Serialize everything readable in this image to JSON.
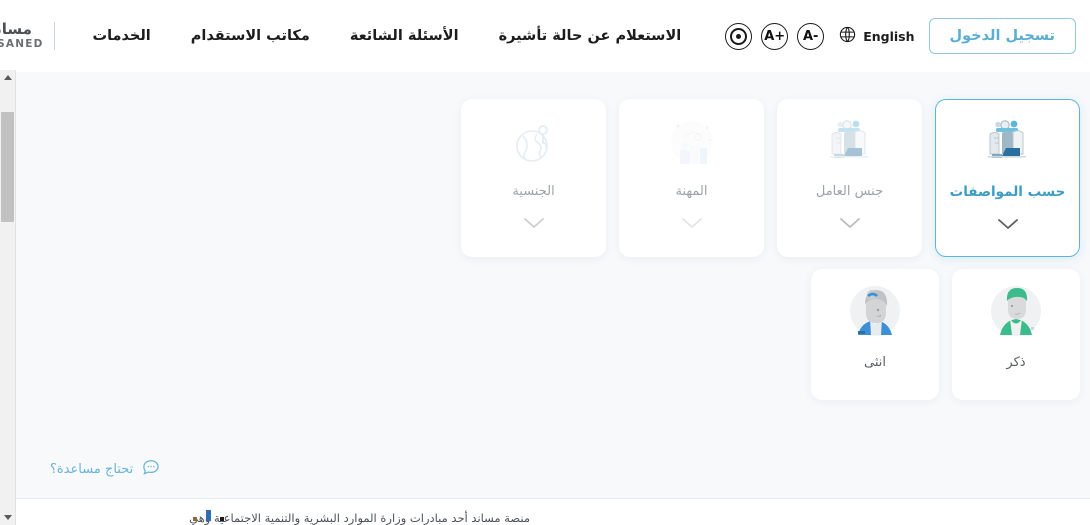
{
  "header": {
    "logo": {
      "brand_ar": "مساند",
      "brand_en": "MUSANED",
      "menu_icon": "hamburger-menu-icon",
      "house_icon": "house-logo-icon"
    },
    "nav_items": [
      {
        "label": "الخدمات",
        "name": "nav-services"
      },
      {
        "label": "مكاتب الاستقدام",
        "name": "nav-recruitment-offices"
      },
      {
        "label": "الأسئلة الشائعة",
        "name": "nav-faq"
      },
      {
        "label": "الاستعلام عن حالة تأشيرة",
        "name": "nav-visa-status-inquiry"
      }
    ],
    "accessibility": {
      "eye_icon": "eye-contrast-icon",
      "font_increase_label": "A+",
      "font_decrease_label": "A-"
    },
    "language": {
      "globe_icon": "globe-language-icon",
      "label": "English"
    },
    "login_label": "تسجيل الدخول"
  },
  "main": {
    "filter_cards": [
      {
        "label": "الجنسية",
        "name": "filter-card-nationality",
        "icon": "globe-pin-icon",
        "active": false,
        "dim": "dim-1"
      },
      {
        "label": "المهنة",
        "name": "filter-card-profession",
        "icon": "worker-profession-icon",
        "active": false,
        "dim": "dim-2"
      },
      {
        "label": "جنس العامل",
        "name": "filter-card-worker-gender",
        "icon": "two-faces-gears-icon",
        "active": false,
        "dim": "dim-3"
      },
      {
        "label": "حسب المواصفات",
        "name": "filter-card-by-specifications",
        "icon": "two-faces-gears-icon",
        "active": true,
        "dim": ""
      }
    ],
    "gender_options": [
      {
        "label": "انثى",
        "name": "gender-option-female",
        "icon": "female-avatar-icon",
        "color": "#3d8fd6"
      },
      {
        "label": "ذكر",
        "name": "gender-option-male",
        "icon": "male-avatar-icon",
        "color": "#3cbc8d"
      }
    ],
    "help": {
      "label": "تحتاج مساعدة؟",
      "icon": "chat-bubble-icon"
    }
  },
  "footer": {
    "text": "منصة مساند أحد مبادرات وزارة الموارد البشرية والتنمية الاجتماعية وهي"
  },
  "colors": {
    "accent_blue": "#5cb5d8",
    "active_text": "#3c9cc4",
    "page_background": "#f8f9fb",
    "card_background": "#ffffff",
    "muted_text": "#9aa3ac"
  },
  "scrollbar": {
    "up_arrow": "scroll-up-arrow-icon",
    "down_arrow": "scroll-down-arrow-icon"
  }
}
